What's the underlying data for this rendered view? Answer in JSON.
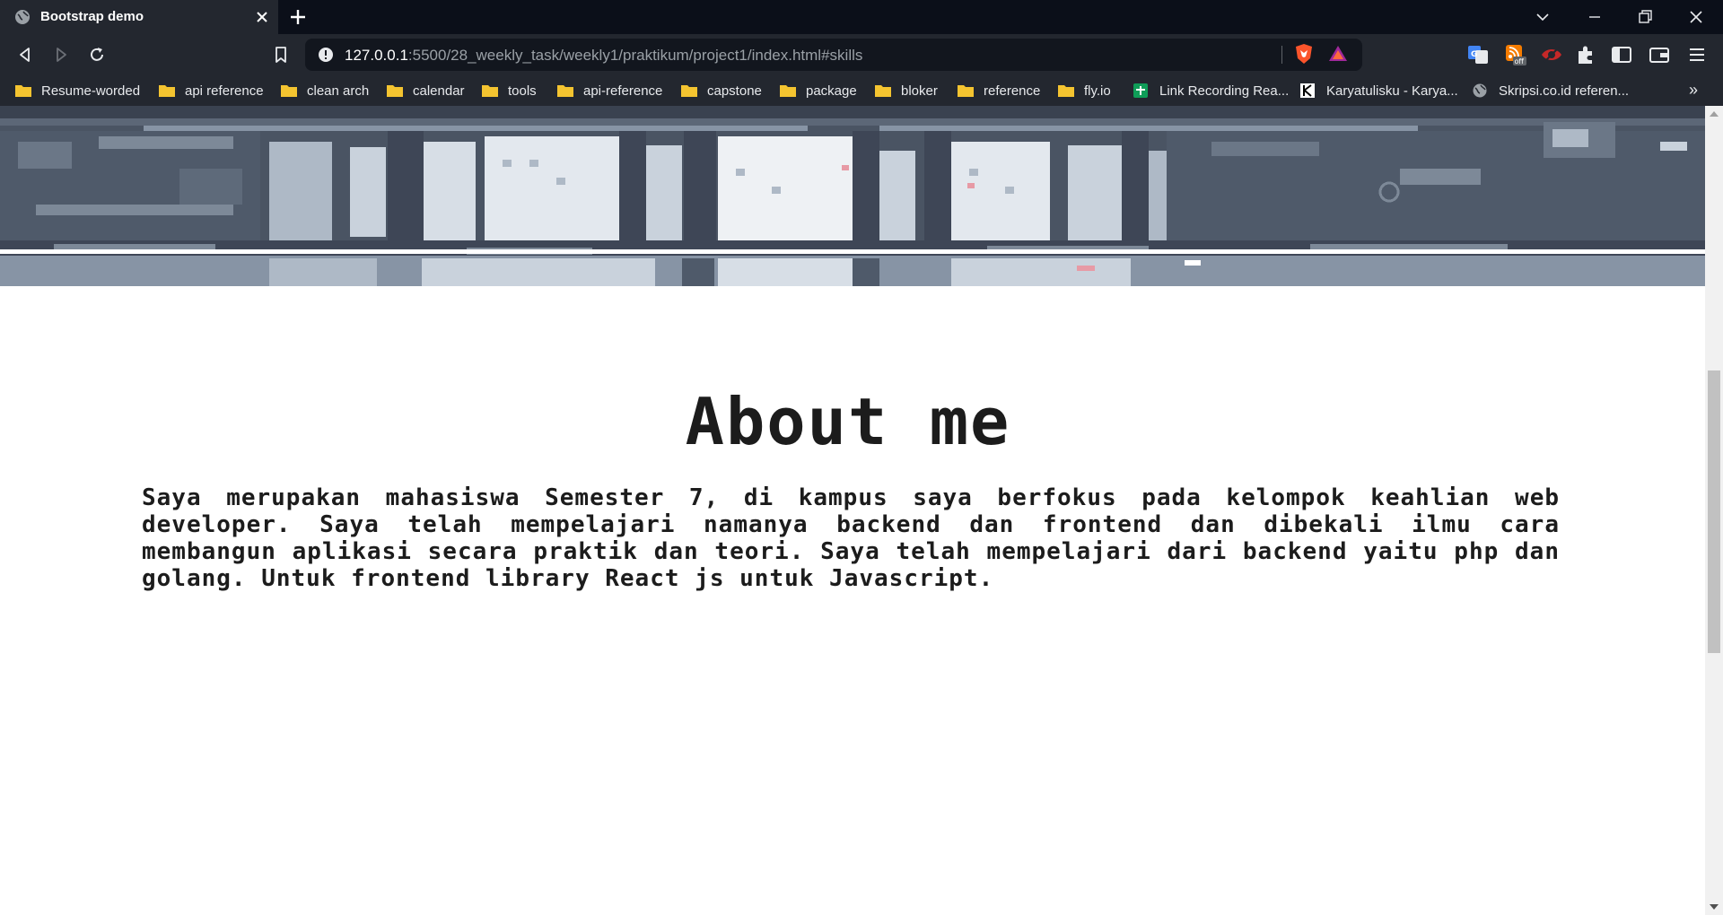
{
  "browser": {
    "tab": {
      "title": "Bootstrap demo"
    },
    "url": {
      "host": "127.0.0.1",
      "path": ":5500/28_weekly_task/weekly1/praktikum/project1/index.html#skills"
    },
    "bookmarks": [
      {
        "label": "Resume-worded",
        "icon": "folder-icon"
      },
      {
        "label": "api reference",
        "icon": "folder-icon"
      },
      {
        "label": "clean arch",
        "icon": "folder-icon"
      },
      {
        "label": "calendar",
        "icon": "folder-icon"
      },
      {
        "label": "tools",
        "icon": "folder-icon"
      },
      {
        "label": "api-reference",
        "icon": "folder-icon"
      },
      {
        "label": "capstone",
        "icon": "folder-icon"
      },
      {
        "label": "package",
        "icon": "folder-icon"
      },
      {
        "label": "bloker",
        "icon": "folder-icon"
      },
      {
        "label": "reference",
        "icon": "folder-icon"
      },
      {
        "label": "fly.io",
        "icon": "folder-icon"
      },
      {
        "label": "Link Recording Rea...",
        "icon": "sheets-icon"
      },
      {
        "label": "Karyatulisku - Karya...",
        "icon": "k-logo-icon"
      },
      {
        "label": "Skripsi.co.id referen...",
        "icon": "globe-icon"
      }
    ],
    "more_label": "»",
    "extension_badge": "off"
  },
  "page": {
    "about": {
      "title": "About me",
      "text": "Saya merupakan mahasiswa Semester 7, di kampus saya berfokus pada kelompok keahlian web developer. Saya telah mempelajari namanya backend dan frontend dan dibekali ilmu cara membangun aplikasi secara praktik dan teori. Saya telah mempelajari dari backend yaitu php dan golang. Untuk frontend library React js untuk Javascript."
    }
  },
  "colors": {
    "chrome_bg": "#0b0f19",
    "toolbar_bg": "#23272f",
    "folder": "#f4c430",
    "hero_dark": "#3e4656",
    "hero_light": "#c9d2dc",
    "text": "#1c1c1c"
  }
}
